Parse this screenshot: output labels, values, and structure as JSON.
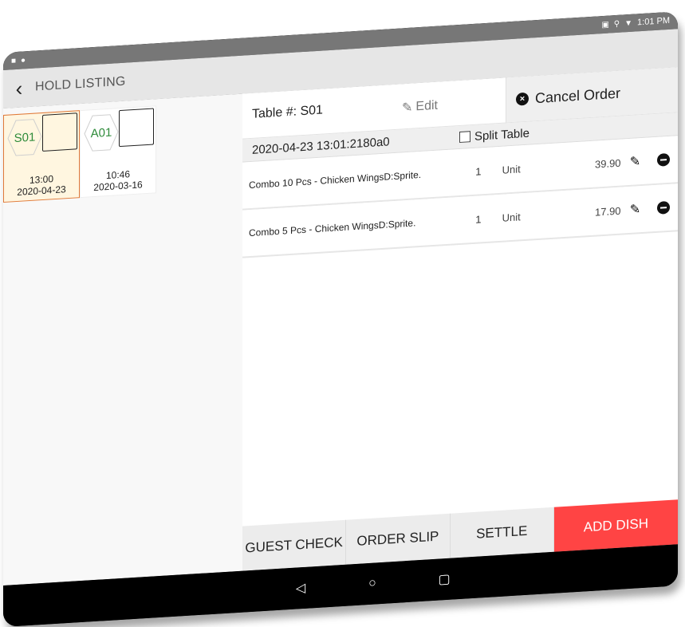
{
  "status_bar": {
    "left_icons": [
      "video-icon",
      "notification-icon"
    ],
    "right_icons": [
      "cast-icon",
      "location-icon",
      "wifi-icon"
    ],
    "time": "1:01 PM"
  },
  "app_bar": {
    "back_icon": "chevron-left-icon",
    "title": "HOLD LISTING"
  },
  "hold_list": [
    {
      "table": "S01",
      "time": "13:00",
      "date": "2020-04-23",
      "selected": true
    },
    {
      "table": "A01",
      "time": "10:46",
      "date": "2020-03-16",
      "selected": false
    }
  ],
  "order": {
    "table_label": "Table #: S01",
    "edit_label": "Edit",
    "cancel_label": "Cancel Order",
    "order_id": "2020-04-23 13:01:2180a0",
    "split_table_label": "Split Table",
    "split_table_checked": false,
    "items": [
      {
        "name": "Combo 10 Pcs - Chicken WingsD:Sprite.",
        "qty": "1",
        "unit": "Unit",
        "price": "39.90"
      },
      {
        "name": "Combo 5 Pcs - Chicken WingsD:Sprite.",
        "qty": "1",
        "unit": "Unit",
        "price": "17.90"
      }
    ]
  },
  "actions": {
    "guest_check": "GUEST CHECK",
    "order_slip": "ORDER SLIP",
    "settle": "SETTLE",
    "add_dish": "ADD DISH"
  },
  "colors": {
    "accent": "#ff4444",
    "selected_card_bg": "#fff6e0",
    "selected_card_border": "#e07a3a",
    "table_code": "#2e8b3a"
  },
  "nav_bar": {
    "back": "◁",
    "home": "○",
    "recents": "▢"
  }
}
